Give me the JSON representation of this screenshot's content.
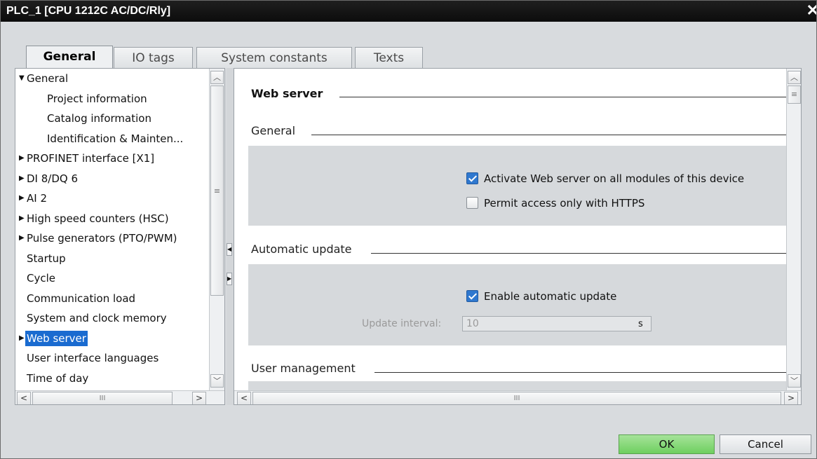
{
  "window": {
    "title": "PLC_1 [CPU 1212C AC/DC/Rly]",
    "close_glyph": "✕"
  },
  "tabs": [
    {
      "label": "General",
      "active": true
    },
    {
      "label": "IO tags",
      "active": false
    },
    {
      "label": "System constants",
      "active": false
    },
    {
      "label": "Texts",
      "active": false
    }
  ],
  "nav": {
    "items": [
      {
        "label": "General",
        "expander": "expanded",
        "level": 0
      },
      {
        "label": "Project information",
        "level": 2
      },
      {
        "label": "Catalog information",
        "level": 2
      },
      {
        "label": "Identification & Mainten...",
        "level": 2
      },
      {
        "label": "PROFINET interface [X1]",
        "expander": "collapsed",
        "level": 0
      },
      {
        "label": "DI 8/DQ 6",
        "expander": "collapsed",
        "level": 0
      },
      {
        "label": "AI 2",
        "expander": "collapsed",
        "level": 0
      },
      {
        "label": "High speed counters (HSC)",
        "expander": "collapsed",
        "level": 0
      },
      {
        "label": "Pulse generators (PTO/PWM)",
        "expander": "collapsed",
        "level": 0
      },
      {
        "label": "Startup",
        "level": 1
      },
      {
        "label": "Cycle",
        "level": 1
      },
      {
        "label": "Communication load",
        "level": 1
      },
      {
        "label": "System and clock memory",
        "level": 1
      },
      {
        "label": "Web server",
        "expander": "collapsed",
        "level": 0,
        "selected": true
      },
      {
        "label": "User interface languages",
        "level": 1
      },
      {
        "label": "Time of day",
        "level": 1
      }
    ],
    "hscroll_grip": "III"
  },
  "content": {
    "section_title": "Web server",
    "general": {
      "heading": "General",
      "activate_web_server": {
        "label": "Activate Web server on all modules of this device",
        "checked": true
      },
      "https_only": {
        "label": "Permit access only with HTTPS",
        "checked": false
      }
    },
    "automatic_update": {
      "heading": "Automatic update",
      "enable": {
        "label": "Enable automatic update",
        "checked": true
      },
      "interval_label": "Update interval:",
      "interval_value": "10",
      "interval_unit": "s"
    },
    "user_management": {
      "heading": "User management"
    },
    "hscroll_grip": "III"
  },
  "footer": {
    "ok_label": "OK",
    "cancel_label": "Cancel"
  },
  "colors": {
    "ok_button": "#7fd46f",
    "selection": "#1a6bd0",
    "checkbox_on": "#2f78cf"
  }
}
